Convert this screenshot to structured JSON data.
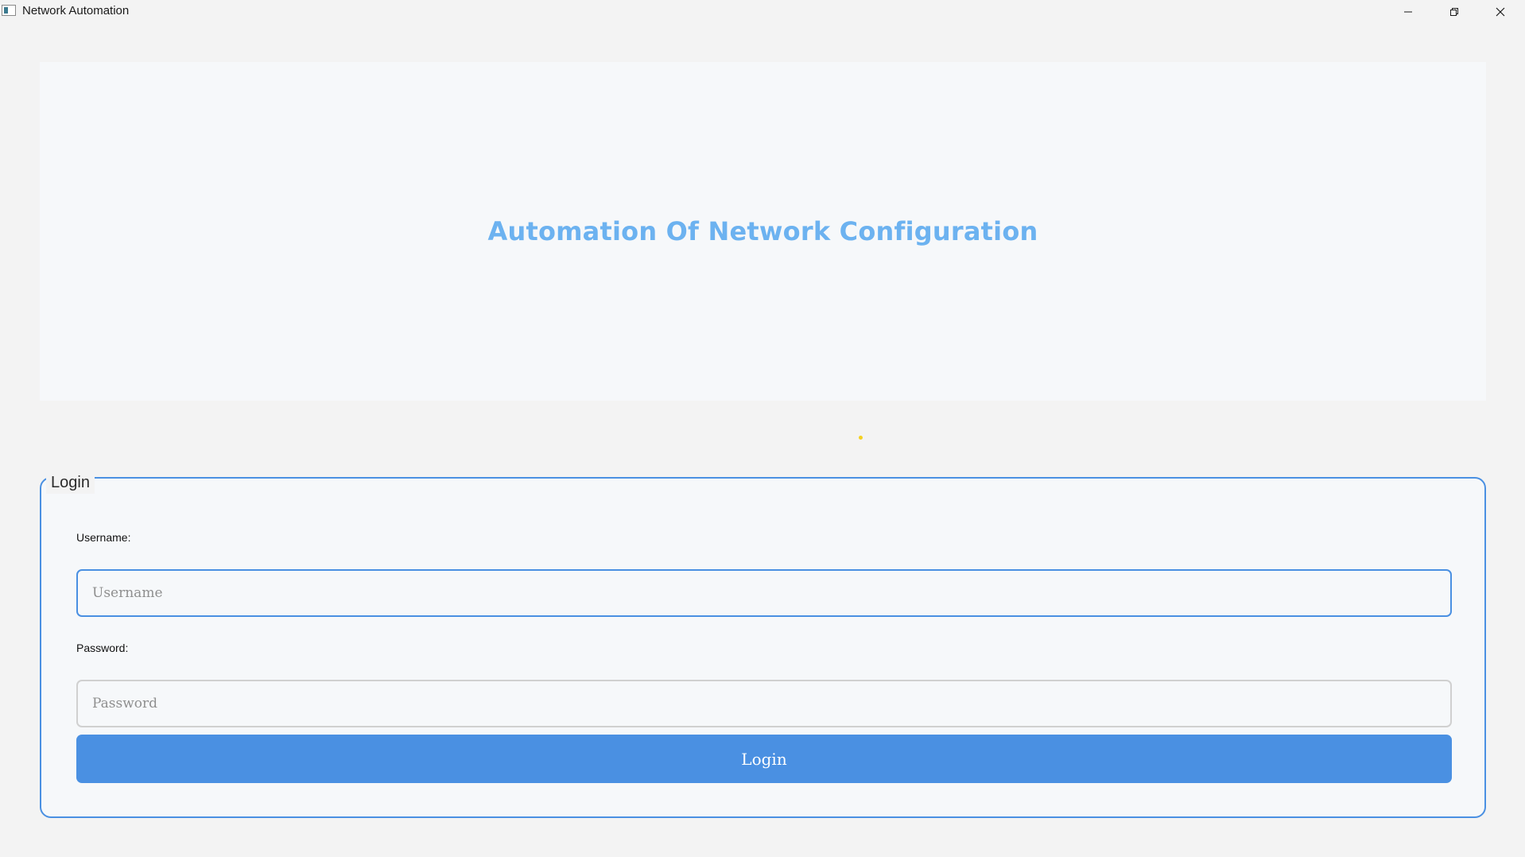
{
  "window": {
    "title": "Network Automation",
    "controls": {
      "minimize_icon": "minimize-icon",
      "maximize_icon": "restore-icon",
      "close_icon": "close-icon"
    }
  },
  "header": {
    "title": "Automation Of Network Configuration",
    "title_color": "#6cb2f0"
  },
  "login": {
    "group_title": "Login",
    "username_label": "Username:",
    "username_value": "",
    "username_placeholder": "Username",
    "password_label": "Password:",
    "password_value": "",
    "password_placeholder": "Password",
    "submit_label": "Login",
    "accent_color": "#4a90e2"
  }
}
